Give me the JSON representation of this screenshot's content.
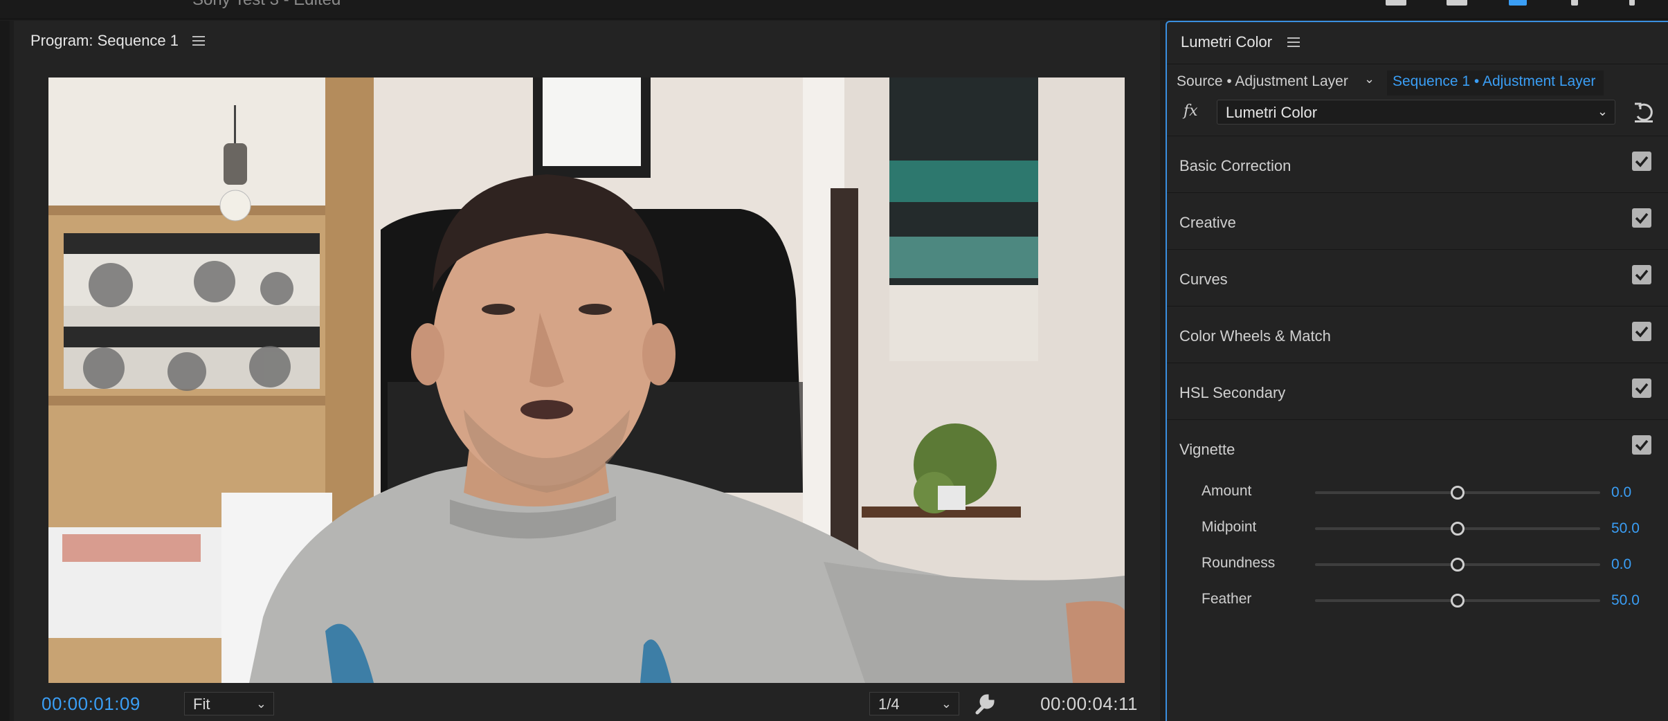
{
  "app_title": "Sony Test 3 - Edited",
  "program_monitor": {
    "title": "Program: Sequence 1",
    "current_timecode": "00:00:01:09",
    "duration_timecode": "00:00:04:11",
    "zoom_select": "Fit",
    "resolution_select": "1/4"
  },
  "lumetri": {
    "title": "Lumetri Color",
    "source_tab": "Source • Adjustment Layer",
    "sequence_tab": "Sequence 1 • Adjustment Layer",
    "fx_label": "fx",
    "effect_select": "Lumetri Color",
    "sections": [
      {
        "label": "Basic Correction",
        "enabled": true
      },
      {
        "label": "Creative",
        "enabled": true
      },
      {
        "label": "Curves",
        "enabled": true
      },
      {
        "label": "Color Wheels & Match",
        "enabled": true
      },
      {
        "label": "HSL Secondary",
        "enabled": true
      },
      {
        "label": "Vignette",
        "enabled": true
      }
    ],
    "vignette_sliders": [
      {
        "label": "Amount",
        "value": "0.0",
        "position": 0.5
      },
      {
        "label": "Midpoint",
        "value": "50.0",
        "position": 0.5
      },
      {
        "label": "Roundness",
        "value": "0.0",
        "position": 0.5
      },
      {
        "label": "Feather",
        "value": "50.0",
        "position": 0.5
      }
    ]
  },
  "colors": {
    "accent": "#3a9ef5",
    "panel_bg": "#232323",
    "focus_border": "#3a8fe0"
  },
  "icons": [
    "hamburger-menu-icon",
    "chevron-down-icon",
    "wrench-icon",
    "reset-icon",
    "checkbox-checked-icon"
  ]
}
